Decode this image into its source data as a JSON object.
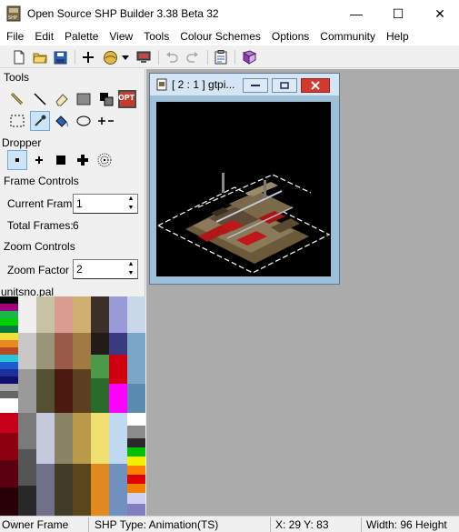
{
  "window": {
    "title": "Open Source SHP Builder 3.38 Beta 32",
    "minimize_glyph": "—",
    "maximize_glyph": "☐",
    "close_glyph": "✕"
  },
  "menu": [
    "File",
    "Edit",
    "Palette",
    "View",
    "Tools",
    "Colour Schemes",
    "Options",
    "Community",
    "Help"
  ],
  "panel": {
    "tools_label": "Tools",
    "dropper_label": "Dropper",
    "frame_controls_label": "Frame Controls",
    "current_frame_label": "Current Frame",
    "current_frame_value": "1",
    "total_frames_label": "Total Frames:",
    "total_frames_value": "6",
    "zoom_controls_label": "Zoom Controls",
    "zoom_factor_label": "Zoom Factor",
    "zoom_factor_value": "2",
    "palette_name": "unitsno.pal",
    "opt_badge": "OPT"
  },
  "child_window": {
    "title": "[ 2 : 1 ] gtpi..."
  },
  "status": {
    "frame": "Owner Frame",
    "shp_type": "SHP Type: Animation(TS)",
    "coords": "X: 29 Y: 83",
    "size": "Width: 96 Height"
  },
  "colors": {
    "accent": "#cce4f7",
    "mdi_background": "#ababab",
    "child_border": "#9dbfd8"
  }
}
